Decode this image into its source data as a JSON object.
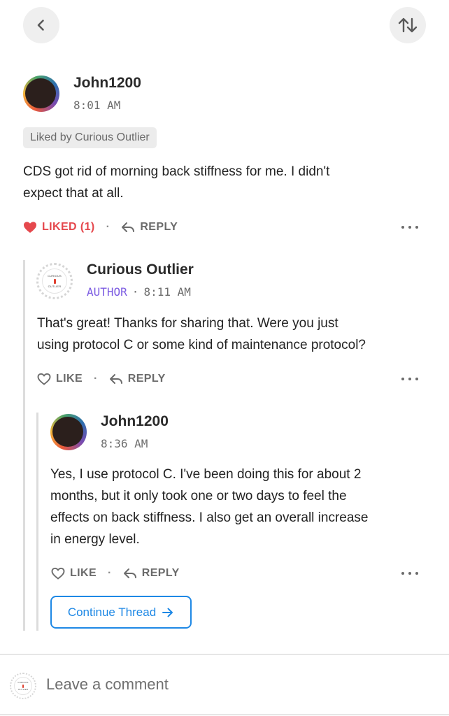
{
  "header": {
    "back_icon": "chevron-left-icon",
    "sort_icon": "sort-arrows-icon"
  },
  "comments": [
    {
      "author": "John1200",
      "time": "8:01 AM",
      "avatar": "dark-circle-avatar",
      "liked_by": "Liked by Curious Outlier",
      "text_lines": [
        "CDS got rid of morning back stiffness for me. I didn't",
        "expect that at all."
      ],
      "like_label": "LIKED (1)",
      "reply_label": "REPLY"
    },
    {
      "author": "Curious Outlier",
      "role": "AUTHOR",
      "time": "8:11 AM",
      "avatar": "curious-outlier-seal",
      "avatar_text_top": "CURIOUS",
      "avatar_text_bottom": "OUTLIER",
      "text_lines": [
        "That's great! Thanks for sharing that. Were you just",
        "using protocol C or some kind of maintenance protocol?"
      ],
      "like_label": "LIKE",
      "reply_label": "REPLY"
    },
    {
      "author": "John1200",
      "time": "8:36 AM",
      "avatar": "dark-circle-avatar",
      "text_lines": [
        "Yes, I use protocol C. I've been doing this for about 2",
        "months, but it only took one or two days to feel the",
        "effects on back stiffness. I also get an overall increase",
        "in energy level."
      ],
      "like_label": "LIKE",
      "reply_label": "REPLY"
    }
  ],
  "continue_thread": "Continue Thread",
  "composer": {
    "placeholder": "Leave a comment"
  },
  "colors": {
    "liked": "#e5484d",
    "author_badge": "#7c5ce2",
    "link_blue": "#1e88e5"
  }
}
